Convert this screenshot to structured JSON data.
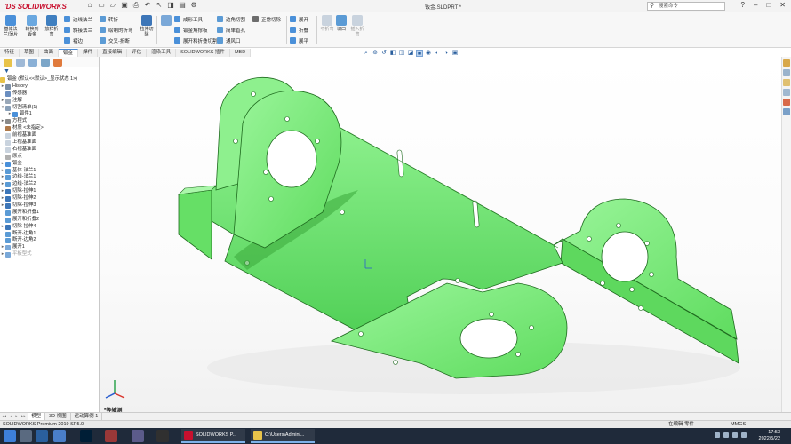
{
  "titlebar": {
    "logo_text": "SOLIDWORKS",
    "document_title": "钣金.SLDPRT *",
    "search_placeholder": "搜索命令"
  },
  "ribbon": {
    "big_buttons": [
      {
        "label": "基体法兰/薄片",
        "icon": "base-flange-icon"
      },
      {
        "label": "转换到钣金",
        "icon": "convert-icon"
      },
      {
        "label": "放样折弯",
        "icon": "lofted-bend-icon"
      }
    ],
    "col1": [
      "边线法兰",
      "斜接法兰",
      "褶边"
    ],
    "col2": [
      "转折",
      "绘制的折弯",
      "交叉-折断"
    ],
    "col3_big": {
      "label": "拉伸切除",
      "icon": "extruded-cut-icon"
    },
    "col4": [
      "成形工具",
      "钣金角撑板",
      "展开和折叠切割"
    ],
    "col5": [
      "边角切割",
      "简单直孔",
      "通风口"
    ],
    "col6": [
      "正常切除",
      ""
    ],
    "col7": [
      "展开",
      "折叠",
      "展平"
    ],
    "col8": [
      "切口",
      "插入折弯",
      ""
    ],
    "greyed": [
      "不折弯",
      "插入折弯"
    ]
  },
  "command_tabs": [
    "特征",
    "草图",
    "曲面",
    "钣金",
    "焊件",
    "直接编辑",
    "评估",
    "渲染工具",
    "SOLIDWORKS 插件",
    "MBD"
  ],
  "active_tab": "钣金",
  "tree": {
    "root": "钣金 (默认<<默认>_显示状态 1>)",
    "items": [
      {
        "label": "History",
        "arrow": "▸",
        "icon": "history"
      },
      {
        "label": "传感器",
        "arrow": "",
        "icon": "sensor"
      },
      {
        "label": "注解",
        "arrow": "▸",
        "icon": "annot"
      },
      {
        "label": "切割清单(1)",
        "arrow": "▾",
        "icon": "cutlist"
      },
      {
        "label": "钣件1",
        "arrow": "▸",
        "icon": "body",
        "indent": 1
      },
      {
        "label": "方程式",
        "arrow": "▸",
        "icon": "eq"
      },
      {
        "label": "材质 <未指定>",
        "arrow": "",
        "icon": "mat"
      },
      {
        "label": "前视基准面",
        "arrow": "",
        "icon": "plane"
      },
      {
        "label": "上视基准面",
        "arrow": "",
        "icon": "plane"
      },
      {
        "label": "右视基准面",
        "arrow": "",
        "icon": "plane"
      },
      {
        "label": "原点",
        "arrow": "",
        "icon": "origin"
      },
      {
        "label": "钣金",
        "arrow": "▸",
        "icon": "sm"
      },
      {
        "label": "基体-法兰1",
        "arrow": "▸",
        "icon": "feat"
      },
      {
        "label": "边线-法兰1",
        "arrow": "▸",
        "icon": "feat"
      },
      {
        "label": "边线-法兰2",
        "arrow": "▸",
        "icon": "feat"
      },
      {
        "label": "切除-拉伸1",
        "arrow": "▸",
        "icon": "cut"
      },
      {
        "label": "切除-拉伸2",
        "arrow": "▸",
        "icon": "cut"
      },
      {
        "label": "切除-拉伸3",
        "arrow": "▸",
        "icon": "cut"
      },
      {
        "label": "展开和折叠1",
        "arrow": "",
        "icon": "feat"
      },
      {
        "label": "展开和折叠2",
        "arrow": "",
        "icon": "feat"
      },
      {
        "label": "切除-拉伸4",
        "arrow": "▸",
        "icon": "cut"
      },
      {
        "label": "断开-边角1",
        "arrow": "",
        "icon": "feat"
      },
      {
        "label": "断开-边角2",
        "arrow": "",
        "icon": "feat"
      },
      {
        "label": "展开1",
        "arrow": "▸",
        "icon": "flat"
      },
      {
        "label": "平板型式",
        "arrow": "▸",
        "icon": "flat",
        "gray": true
      }
    ]
  },
  "viewport": {
    "view_name": "*等轴测"
  },
  "bottom_tabs": [
    "模型",
    "3D 视图",
    "运动算例 1"
  ],
  "active_bottom_tab": "模型",
  "status": {
    "left": "SOLIDWORKS Premium 2019 SP5.0",
    "mode": "在编辑 零件",
    "units": "MMGS"
  },
  "taskbar": {
    "windows": [
      "SOLIDWORKS P...",
      "C:\\Users\\Admini..."
    ],
    "time": "17:53",
    "date": "2022/5/22"
  },
  "colors": {
    "part_fill": "#7df07a",
    "part_edge": "#1f6b1f",
    "accent": "#2a5f9e",
    "brand": "#c8102e"
  }
}
